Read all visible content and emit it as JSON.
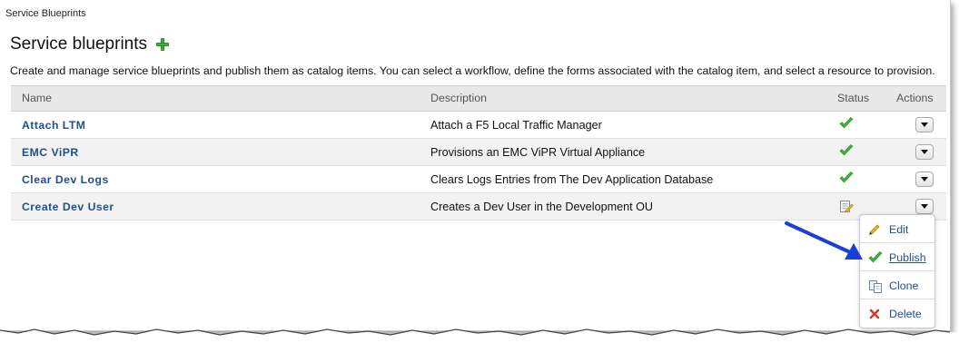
{
  "window": {
    "title": "Service Blueprints"
  },
  "page": {
    "heading": "Service blueprints",
    "intro": "Create and manage service blueprints and publish them as catalog items. You can select a workflow, define the forms associated with the catalog item, and select a resource to provision."
  },
  "table": {
    "columns": {
      "name": "Name",
      "description": "Description",
      "status": "Status",
      "actions": "Actions"
    },
    "rows": [
      {
        "name": "Attach LTM",
        "description": "Attach a F5 Local Traffic Manager",
        "status": "published"
      },
      {
        "name": "EMC ViPR",
        "description": "Provisions an EMC ViPR Virtual Appliance",
        "status": "published"
      },
      {
        "name": "Clear Dev Logs",
        "description": "Clears Logs Entries from The Dev Application Database",
        "status": "published"
      },
      {
        "name": "Create Dev User",
        "description": "Creates a Dev User in the Development OU",
        "status": "draft"
      }
    ]
  },
  "actions_menu": {
    "items": [
      {
        "label": "Edit",
        "icon": "pencil-icon"
      },
      {
        "label": "Publish",
        "icon": "check-icon"
      },
      {
        "label": "Clone",
        "icon": "copy-icon"
      },
      {
        "label": "Delete",
        "icon": "delete-x-icon"
      }
    ]
  },
  "colors": {
    "link": "#1e5189",
    "check": "#3bb33b",
    "header_bg": "#e8e8e8",
    "callout_arrow": "#1a3ed8"
  }
}
